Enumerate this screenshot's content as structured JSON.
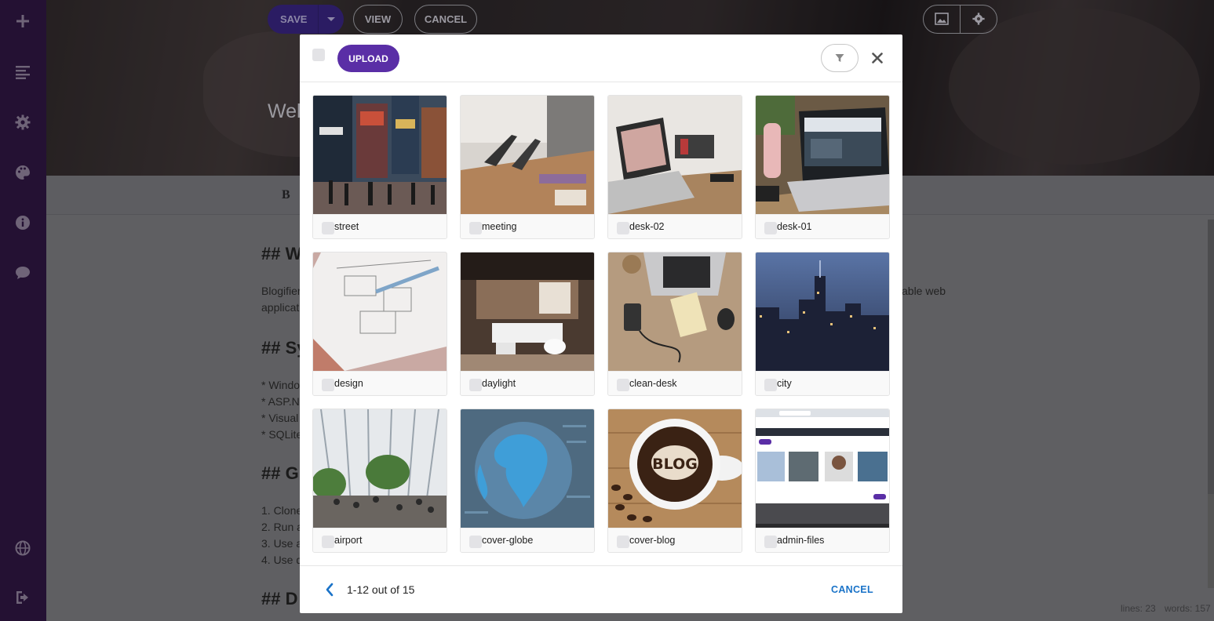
{
  "background": {
    "top_buttons": {
      "save": "SAVE",
      "view": "VIEW",
      "cancel": "CANCEL"
    },
    "hero_title": "Wel",
    "toolbar_bold": "B",
    "editor_lines": [
      "## W",
      "Blogifier",
      "able web",
      "applicati",
      "## Sy",
      "* Windo",
      "* ASP.NI",
      "* Visual",
      "* SQLite",
      "## G",
      "1. Clone",
      "2. Run a",
      "3. Use a",
      "4. Use d",
      "## D"
    ],
    "stats": {
      "lines": "lines: 23",
      "words": "words: 157"
    }
  },
  "sidebar": {
    "items": [
      {
        "icon": "plus-icon"
      },
      {
        "icon": "list-icon"
      },
      {
        "icon": "gear-icon"
      },
      {
        "icon": "palette-icon"
      },
      {
        "icon": "info-icon"
      },
      {
        "icon": "chat-icon"
      },
      {
        "icon": "globe-icon"
      },
      {
        "icon": "sign-out-icon"
      }
    ]
  },
  "modal": {
    "upload_label": "UPLOAD",
    "cancel_label": "CANCEL",
    "pagination": "1-12 out of 15",
    "files": [
      {
        "name": "street"
      },
      {
        "name": "meeting"
      },
      {
        "name": "desk-02"
      },
      {
        "name": "desk-01"
      },
      {
        "name": "design"
      },
      {
        "name": "daylight"
      },
      {
        "name": "clean-desk"
      },
      {
        "name": "city"
      },
      {
        "name": "airport"
      },
      {
        "name": "cover-globe"
      },
      {
        "name": "cover-blog"
      },
      {
        "name": "admin-files"
      }
    ],
    "thumbnail_texts": {
      "cover_blog": "BLOG"
    }
  },
  "colors": {
    "brand": "#5a2ea6",
    "sidebar": "#241133",
    "link": "#1a73c8"
  }
}
